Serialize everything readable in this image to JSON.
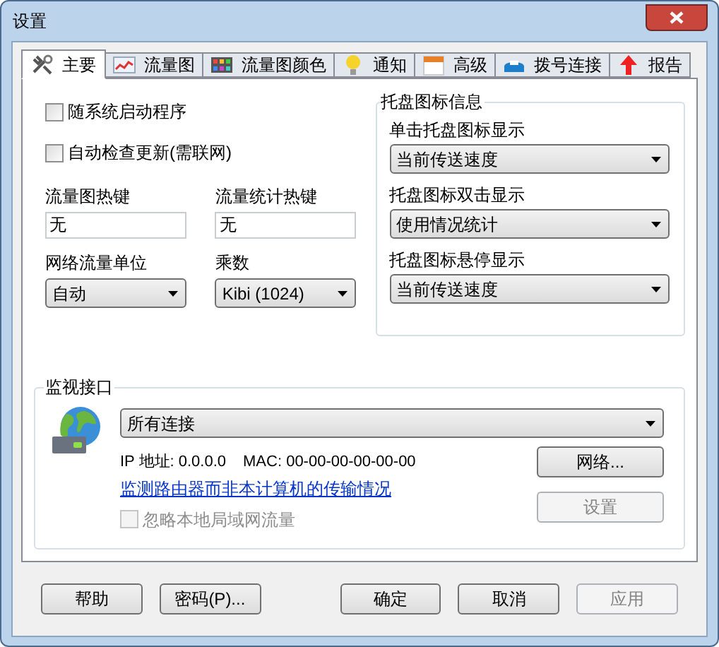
{
  "window": {
    "title": "设置"
  },
  "tabs": [
    {
      "label": "主要",
      "selected": true
    },
    {
      "label": "流量图",
      "selected": false
    },
    {
      "label": "流量图颜色",
      "selected": false
    },
    {
      "label": "通知",
      "selected": false
    },
    {
      "label": "高级",
      "selected": false
    },
    {
      "label": "拨号连接",
      "selected": false
    },
    {
      "label": "报告",
      "selected": false
    }
  ],
  "general": {
    "checkboxes": [
      {
        "label": "随系统启动程序",
        "checked": false
      },
      {
        "label": "自动检查更新(需联网)",
        "checked": false
      }
    ],
    "hotkeys": [
      {
        "label": "流量图热键",
        "value": "无"
      },
      {
        "label": "流量统计热键",
        "value": "无"
      }
    ],
    "dropdowns": [
      {
        "label": "网络流量单位",
        "value": "自动"
      },
      {
        "label": "乘数",
        "value": "Kibi (1024)"
      }
    ]
  },
  "tray": {
    "title": "托盘图标信息",
    "items": [
      {
        "label": "单击托盘图标显示",
        "value": "当前传送速度"
      },
      {
        "label": "托盘图标双击显示",
        "value": "使用情况统计"
      },
      {
        "label": "托盘图标悬停显示",
        "value": "当前传送速度"
      }
    ]
  },
  "monitor": {
    "title": "监视接口",
    "connection": "所有连接",
    "ip": "IP 地址: 0.0.0.0",
    "mac": "MAC: 00-00-00-00-00-00",
    "link": "监测路由器而非本计算机的传输情况",
    "ignore_lan": {
      "label": "忽略本地局域网流量",
      "checked": false,
      "disabled": true
    },
    "buttons": [
      {
        "label": "网络...",
        "disabled": false
      },
      {
        "label": "设置",
        "disabled": true
      }
    ]
  },
  "buttons": [
    {
      "label": "帮助",
      "disabled": false
    },
    {
      "label": "密码(P)...",
      "disabled": false
    },
    {
      "label": "确定",
      "disabled": false
    },
    {
      "label": "取消",
      "disabled": false
    },
    {
      "label": "应用",
      "disabled": true
    }
  ]
}
